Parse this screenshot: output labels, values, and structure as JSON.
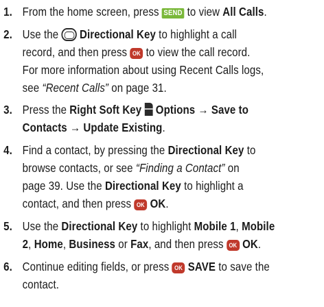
{
  "steps": [
    {
      "number": "1.",
      "lines": [
        {
          "a": "From the home screen, press ",
          "key": "SEND",
          "b": " to view ",
          "bold": "All Calls",
          "c": "."
        }
      ]
    },
    {
      "number": "2.",
      "lines": [
        {
          "a": "Use the ",
          "bold": "Directional Key",
          "b": " to highlight a call"
        },
        {
          "a": "record, and then press ",
          "key": "OK",
          "b": " to view the call record."
        },
        {
          "a": "For more information about using Recent Calls logs,"
        },
        {
          "a": "see ",
          "italic": "“Recent Calls”",
          "b": " on page 31."
        }
      ]
    },
    {
      "number": "3.",
      "lines": [
        {
          "a": "Press the ",
          "bold1": "Right Soft Key",
          "bold2": "Options → Save to"
        },
        {
          "bold": "Contacts → Update Existing",
          "b": "."
        }
      ]
    },
    {
      "number": "4.",
      "lines": [
        {
          "a": "Find a contact, by pressing the ",
          "bold": "Directional Key",
          "b": " to"
        },
        {
          "a": "browse contacts, or see ",
          "italic": "“Finding a Contact”",
          "b": " on"
        },
        {
          "a": "page 39. Use the ",
          "bold": "Directional Key",
          "b": " to highlight a"
        },
        {
          "a": "contact, and then press ",
          "key": "OK",
          "bold": "OK",
          "b": "."
        }
      ]
    },
    {
      "number": "5.",
      "lines": [
        {
          "a": "Use the ",
          "bold1": "Directional Key",
          "b": " to highlight ",
          "bold2": "Mobile 1",
          "c": ", ",
          "bold3": "Mobile"
        },
        {
          "bold1": "2",
          "a": ", ",
          "bold2": "Home",
          "b": ", ",
          "bold3": "Business",
          "c": " or ",
          "bold4": "Fax",
          "d": ", and then press ",
          "key": "OK",
          "bold5": "OK",
          "e": "."
        }
      ]
    },
    {
      "number": "6.",
      "lines": [
        {
          "a": "Continue editing fields, or press ",
          "key": "OK",
          "bold": "SAVE",
          "b": " to save the"
        },
        {
          "a": "contact."
        }
      ]
    }
  ],
  "colors": {
    "send_key": "#7ab83a",
    "ok_key": "#c0392b",
    "text": "#1a1a1a"
  },
  "icons": {
    "send": "send-key-icon",
    "ok": "ok-key-icon",
    "directional": "directional-key-icon",
    "soft": "right-soft-key-icon"
  }
}
